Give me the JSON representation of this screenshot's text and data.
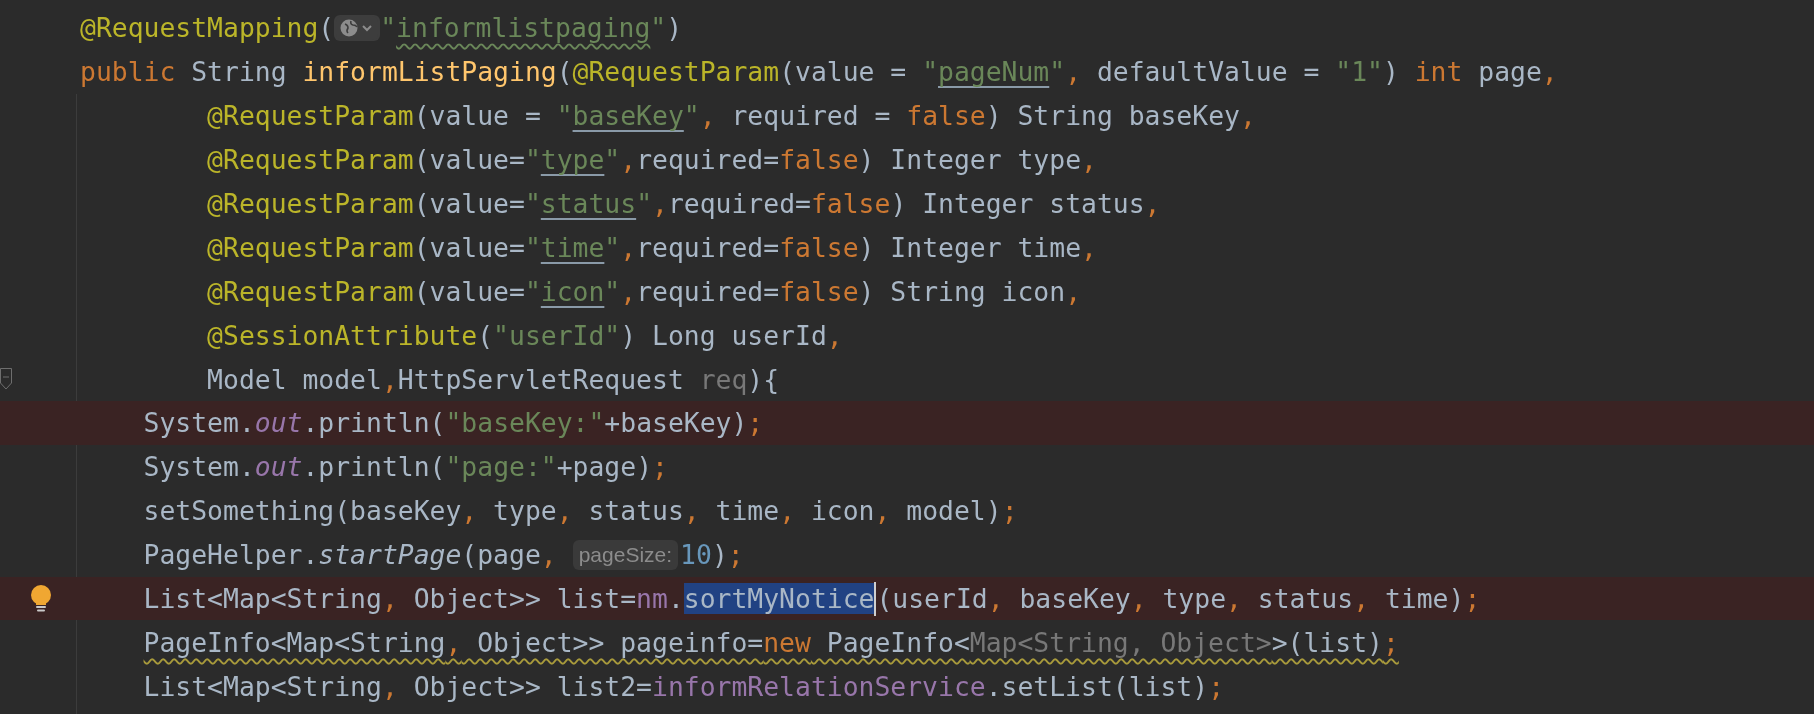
{
  "editor": {
    "lines": [
      {
        "highlighted": false,
        "warning": false,
        "tokens": [
          {
            "kind": "annotation",
            "text": "@RequestMapping"
          },
          {
            "kind": "plain",
            "text": "("
          },
          {
            "kind": "globe"
          },
          {
            "kind": "string",
            "text": "\""
          },
          {
            "kind": "typo",
            "text": "informlistpaging"
          },
          {
            "kind": "string",
            "text": "\""
          },
          {
            "kind": "plain",
            "text": ")"
          }
        ]
      },
      {
        "highlighted": false,
        "warning": false,
        "tokens": [
          {
            "kind": "keyword",
            "text": "public"
          },
          {
            "kind": "plain",
            "text": " String "
          },
          {
            "kind": "decl",
            "text": "informListPaging"
          },
          {
            "kind": "plain",
            "text": "("
          },
          {
            "kind": "annotation",
            "text": "@RequestParam"
          },
          {
            "kind": "plain",
            "text": "(value = "
          },
          {
            "kind": "string",
            "text": "\""
          },
          {
            "kind": "link",
            "text": "pageNum"
          },
          {
            "kind": "string",
            "text": "\""
          },
          {
            "kind": "keyword",
            "text": ","
          },
          {
            "kind": "plain",
            "text": " defaultValue = "
          },
          {
            "kind": "string",
            "text": "\"1\""
          },
          {
            "kind": "plain",
            "text": ") "
          },
          {
            "kind": "keyword",
            "text": "int"
          },
          {
            "kind": "plain",
            "text": " page"
          },
          {
            "kind": "keyword",
            "text": ","
          }
        ]
      },
      {
        "highlighted": false,
        "warning": false,
        "tokens": [
          {
            "kind": "annotation",
            "text": "        @RequestParam"
          },
          {
            "kind": "plain",
            "text": "(value = "
          },
          {
            "kind": "string",
            "text": "\""
          },
          {
            "kind": "link",
            "text": "baseKey"
          },
          {
            "kind": "string",
            "text": "\""
          },
          {
            "kind": "keyword",
            "text": ","
          },
          {
            "kind": "plain",
            "text": " required = "
          },
          {
            "kind": "keyword",
            "text": "false"
          },
          {
            "kind": "plain",
            "text": ") String baseKey"
          },
          {
            "kind": "keyword",
            "text": ","
          }
        ]
      },
      {
        "highlighted": false,
        "warning": false,
        "tokens": [
          {
            "kind": "annotation",
            "text": "        @RequestParam"
          },
          {
            "kind": "plain",
            "text": "(value="
          },
          {
            "kind": "string",
            "text": "\""
          },
          {
            "kind": "link",
            "text": "type"
          },
          {
            "kind": "string",
            "text": "\""
          },
          {
            "kind": "keyword",
            "text": ","
          },
          {
            "kind": "plain",
            "text": "required="
          },
          {
            "kind": "keyword",
            "text": "false"
          },
          {
            "kind": "plain",
            "text": ") Integer type"
          },
          {
            "kind": "keyword",
            "text": ","
          }
        ]
      },
      {
        "highlighted": false,
        "warning": false,
        "tokens": [
          {
            "kind": "annotation",
            "text": "        @RequestParam"
          },
          {
            "kind": "plain",
            "text": "(value="
          },
          {
            "kind": "string",
            "text": "\""
          },
          {
            "kind": "link",
            "text": "status"
          },
          {
            "kind": "string",
            "text": "\""
          },
          {
            "kind": "keyword",
            "text": ","
          },
          {
            "kind": "plain",
            "text": "required="
          },
          {
            "kind": "keyword",
            "text": "false"
          },
          {
            "kind": "plain",
            "text": ") Integer status"
          },
          {
            "kind": "keyword",
            "text": ","
          }
        ]
      },
      {
        "highlighted": false,
        "warning": false,
        "tokens": [
          {
            "kind": "annotation",
            "text": "        @RequestParam"
          },
          {
            "kind": "plain",
            "text": "(value="
          },
          {
            "kind": "string",
            "text": "\""
          },
          {
            "kind": "link",
            "text": "time"
          },
          {
            "kind": "string",
            "text": "\""
          },
          {
            "kind": "keyword",
            "text": ","
          },
          {
            "kind": "plain",
            "text": "required="
          },
          {
            "kind": "keyword",
            "text": "false"
          },
          {
            "kind": "plain",
            "text": ") Integer time"
          },
          {
            "kind": "keyword",
            "text": ","
          }
        ]
      },
      {
        "highlighted": false,
        "warning": false,
        "tokens": [
          {
            "kind": "annotation",
            "text": "        @RequestParam"
          },
          {
            "kind": "plain",
            "text": "(value="
          },
          {
            "kind": "string",
            "text": "\""
          },
          {
            "kind": "link",
            "text": "icon"
          },
          {
            "kind": "string",
            "text": "\""
          },
          {
            "kind": "keyword",
            "text": ","
          },
          {
            "kind": "plain",
            "text": "required="
          },
          {
            "kind": "keyword",
            "text": "false"
          },
          {
            "kind": "plain",
            "text": ") String icon"
          },
          {
            "kind": "keyword",
            "text": ","
          }
        ]
      },
      {
        "highlighted": false,
        "warning": false,
        "tokens": [
          {
            "kind": "annotation",
            "text": "        @SessionAttribute"
          },
          {
            "kind": "plain",
            "text": "("
          },
          {
            "kind": "string",
            "text": "\"userId\""
          },
          {
            "kind": "plain",
            "text": ") Long userId"
          },
          {
            "kind": "keyword",
            "text": ","
          }
        ]
      },
      {
        "highlighted": false,
        "warning": false,
        "gutter": {
          "kind": "fold"
        },
        "tokens": [
          {
            "kind": "plain",
            "text": "        Model model"
          },
          {
            "kind": "keyword",
            "text": ","
          },
          {
            "kind": "plain",
            "text": "HttpServletRequest "
          },
          {
            "kind": "unused",
            "text": "req"
          },
          {
            "kind": "plain",
            "text": "){"
          }
        ]
      },
      {
        "highlighted": true,
        "warning": false,
        "tokens": [
          {
            "kind": "plain",
            "text": "    System."
          },
          {
            "kind": "static",
            "text": "out"
          },
          {
            "kind": "plain",
            "text": ".println("
          },
          {
            "kind": "string",
            "text": "\"baseKey:\""
          },
          {
            "kind": "plain",
            "text": "+baseKey)"
          },
          {
            "kind": "keyword",
            "text": ";"
          }
        ]
      },
      {
        "highlighted": false,
        "warning": false,
        "tokens": [
          {
            "kind": "plain",
            "text": "    System."
          },
          {
            "kind": "static",
            "text": "out"
          },
          {
            "kind": "plain",
            "text": ".println("
          },
          {
            "kind": "string",
            "text": "\"page:\""
          },
          {
            "kind": "plain",
            "text": "+page)"
          },
          {
            "kind": "keyword",
            "text": ";"
          }
        ]
      },
      {
        "highlighted": false,
        "warning": false,
        "tokens": [
          {
            "kind": "plain",
            "text": "    setSomething(baseKey"
          },
          {
            "kind": "keyword",
            "text": ","
          },
          {
            "kind": "plain",
            "text": " type"
          },
          {
            "kind": "keyword",
            "text": ","
          },
          {
            "kind": "plain",
            "text": " status"
          },
          {
            "kind": "keyword",
            "text": ","
          },
          {
            "kind": "plain",
            "text": " time"
          },
          {
            "kind": "keyword",
            "text": ","
          },
          {
            "kind": "plain",
            "text": " icon"
          },
          {
            "kind": "keyword",
            "text": ","
          },
          {
            "kind": "plain",
            "text": " model)"
          },
          {
            "kind": "keyword",
            "text": ";"
          }
        ]
      },
      {
        "highlighted": false,
        "warning": false,
        "tokens": [
          {
            "kind": "plain",
            "text": "    PageHelper."
          },
          {
            "kind": "italic",
            "text": "startPage"
          },
          {
            "kind": "plain",
            "text": "(page"
          },
          {
            "kind": "keyword",
            "text": ","
          },
          {
            "kind": "hint",
            "text": "pageSize:"
          },
          {
            "kind": "number",
            "text": "10"
          },
          {
            "kind": "plain",
            "text": ")"
          },
          {
            "kind": "keyword",
            "text": ";"
          }
        ]
      },
      {
        "highlighted": true,
        "warning": false,
        "gutter": {
          "kind": "bulb"
        },
        "tokens": [
          {
            "kind": "plain",
            "text": "    List<Map<String"
          },
          {
            "kind": "keyword",
            "text": ","
          },
          {
            "kind": "plain",
            "text": " Object>> list="
          },
          {
            "kind": "field",
            "text": "nm"
          },
          {
            "kind": "plain",
            "text": "."
          },
          {
            "kind": "selected",
            "text": "sortMyNotice"
          },
          {
            "kind": "caret"
          },
          {
            "kind": "plain",
            "text": "(userId"
          },
          {
            "kind": "keyword",
            "text": ","
          },
          {
            "kind": "plain",
            "text": " baseKey"
          },
          {
            "kind": "keyword",
            "text": ","
          },
          {
            "kind": "plain",
            "text": " type"
          },
          {
            "kind": "keyword",
            "text": ","
          },
          {
            "kind": "plain",
            "text": " status"
          },
          {
            "kind": "keyword",
            "text": ","
          },
          {
            "kind": "plain",
            "text": " time)"
          },
          {
            "kind": "keyword",
            "text": ";"
          }
        ]
      },
      {
        "highlighted": false,
        "warning": true,
        "tokens": [
          {
            "kind": "plain",
            "text": "    PageInfo<Map<String"
          },
          {
            "kind": "keyword",
            "text": ","
          },
          {
            "kind": "plain",
            "text": " Object>> pageinfo="
          },
          {
            "kind": "keyword",
            "text": "new"
          },
          {
            "kind": "plain",
            "text": " PageInfo<"
          },
          {
            "kind": "unused",
            "text": "Map<String, Object>"
          },
          {
            "kind": "plain",
            "text": ">(list)"
          },
          {
            "kind": "keyword",
            "text": ";"
          }
        ]
      },
      {
        "highlighted": false,
        "warning": false,
        "tokens": [
          {
            "kind": "plain",
            "text": "    List<Map<String"
          },
          {
            "kind": "keyword",
            "text": ","
          },
          {
            "kind": "plain",
            "text": " Object>> list2="
          },
          {
            "kind": "field",
            "text": "informRelationService"
          },
          {
            "kind": "plain",
            "text": ".setList(list)"
          },
          {
            "kind": "keyword",
            "text": ";"
          }
        ]
      }
    ]
  }
}
